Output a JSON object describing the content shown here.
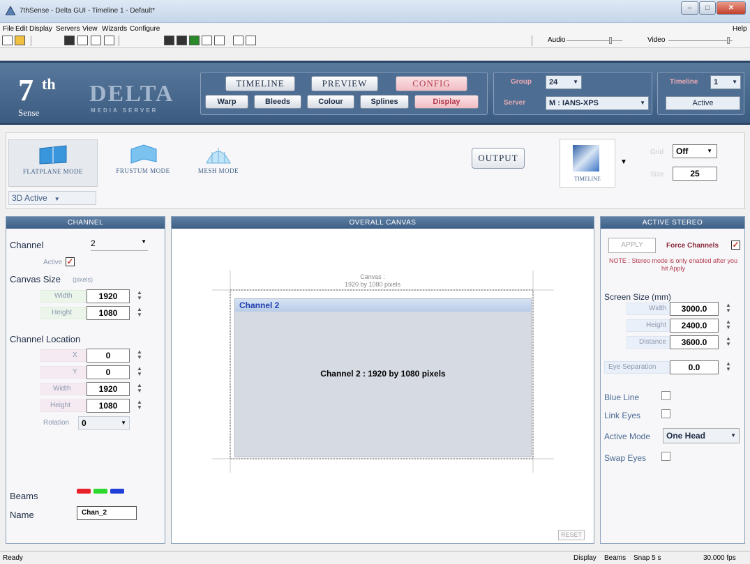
{
  "window": {
    "title": "7thSense - Delta GUI - Timeline 1 - Default*",
    "min": "–",
    "max": "□",
    "close": "✕"
  },
  "menu": {
    "items": [
      "File",
      "Edit",
      "Display",
      "Servers",
      "View",
      "Wizards",
      "Configure"
    ],
    "help": "Help"
  },
  "toolbar": {
    "audio_label": "Audio",
    "video_label": "Video"
  },
  "logo": {
    "seven": "7",
    "th": "th",
    "sense": "Sense",
    "delta": "DELTA",
    "sub": "MEDIA SERVER"
  },
  "nav": {
    "tabs": [
      "TIMELINE",
      "PREVIEW",
      "CONFIG"
    ],
    "subtabs": [
      "Warp",
      "Bleeds",
      "Colour",
      "Splines",
      "Display"
    ],
    "group_label": "Group",
    "group_value": "24",
    "server_label": "Server",
    "server_value": "M : IANS-XPS",
    "timeline_label": "Timeline",
    "timeline_value": "1",
    "active_label": "Active"
  },
  "modes": {
    "items": [
      "FLATPLANE MODE",
      "FRUSTUM MODE",
      "MESH MODE"
    ],
    "dropdown": "3D Active",
    "output": "OUTPUT",
    "timeline": "TIMELINE",
    "grid_label": "Grid",
    "grid_value": "Off",
    "size_label": "Size",
    "size_value": "25"
  },
  "channel": {
    "header": "CHANNEL",
    "channel_label": "Channel",
    "channel_value": "2",
    "active_label": "Active",
    "canvas_size_label": "Canvas Size",
    "pixels_label": "(pixels)",
    "width_label": "Width",
    "width_value": "1920",
    "height_label": "Height",
    "height_value": "1080",
    "location_label": "Channel Location",
    "x_label": "X",
    "x_value": "0",
    "y_label": "Y",
    "y_value": "0",
    "loc_width_label": "Width",
    "loc_width_value": "1920",
    "loc_height_label": "Height",
    "loc_height_value": "1080",
    "rotation_label": "Rotation",
    "rotation_value": "0",
    "beams_label": "Beams",
    "beam_colors": [
      "#e8202a",
      "#2cd92c",
      "#1f3fd8"
    ],
    "name_label": "Name",
    "name_value": "Chan_2"
  },
  "canvas": {
    "header": "OVERALL CANVAS",
    "caption_line1": "Canvas :",
    "caption_line2": "1920 by 1080 pixels",
    "channel_title": "Channel 2",
    "channel_text": "Channel 2 : 1920 by 1080 pixels",
    "reset": "RESET"
  },
  "stereo": {
    "header": "ACTIVE STEREO",
    "apply": "APPLY",
    "force_label": "Force Channels",
    "note": "NOTE : Stereo mode is only enabled after you hit Apply",
    "screen_size_label": "Screen Size (mm)",
    "width_label": "Width",
    "width_value": "3000.0",
    "height_label": "Height",
    "height_value": "2400.0",
    "distance_label": "Distance",
    "distance_value": "3600.0",
    "eye_sep_label": "Eye Separation",
    "eye_sep_value": "0.0",
    "blue_line_label": "Blue Line",
    "link_eyes_label": "Link Eyes",
    "active_mode_label": "Active Mode",
    "active_mode_value": "One Head",
    "swap_eyes_label": "Swap Eyes"
  },
  "status": {
    "left": "Ready",
    "display": "Display",
    "beams": "Beams",
    "snap": "Snap 5 s",
    "fps": "30.000 fps"
  }
}
